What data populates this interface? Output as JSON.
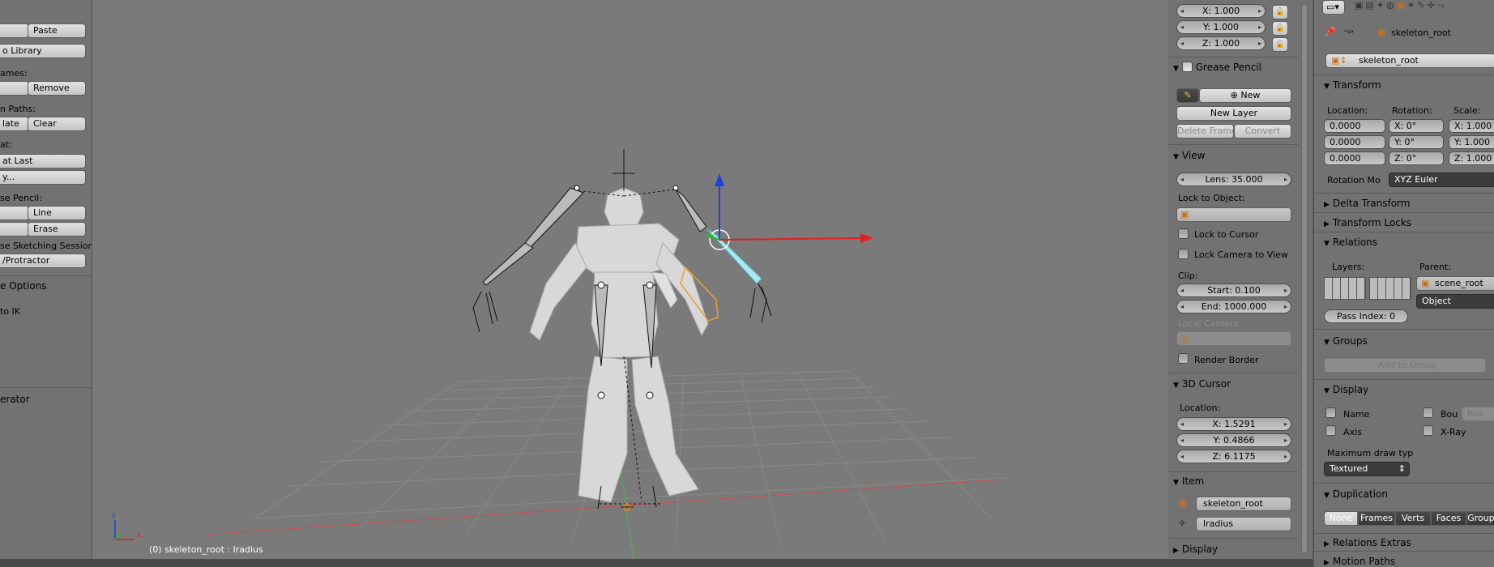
{
  "toolshelf": {
    "paste_label": "Paste",
    "copy_library_label": "o Library",
    "frames_label": "ames:",
    "remove_label": "Remove",
    "motion_paths_label": "n Paths:",
    "calculate_label": "late",
    "clear_label": "Clear",
    "repeat_label": "at:",
    "repeat_last_label": "at Last",
    "history_label": "y...",
    "grease_pencil_label": "se Pencil:",
    "line_label": "Line",
    "erase_label": "Erase",
    "sketching_sessions_label": "se Sketching Sessions",
    "protractor_label": "/Protractor",
    "options_label": "e Options",
    "auto_ik_label": "to IK",
    "operator_label": "erator"
  },
  "viewport": {
    "info_text": "(0) skeleton_root : lradius",
    "axis_x_label": "x",
    "axis_z_label": "z"
  },
  "npanel": {
    "scale_x": "X: 1.000",
    "scale_y": "Y: 1.000",
    "scale_z": "Z: 1.000",
    "grease_pencil_header": "Grease Pencil",
    "new_label": "New",
    "new_layer_label": "New Layer",
    "delete_frame_label": "Delete Frame",
    "convert_label": "Convert",
    "view_header": "View",
    "lens": "Lens: 35.000",
    "lock_to_object_label": "Lock to Object:",
    "lock_to_cursor_label": "Lock to Cursor",
    "lock_camera_label": "Lock Camera to View",
    "clip_label": "Clip:",
    "clip_start": "Start: 0.100",
    "clip_end": "End: 1000.000",
    "local_camera_label": "Local Camera:",
    "render_border_label": "Render Border",
    "cursor_header": "3D Cursor",
    "cursor_location_label": "Location:",
    "cursor_x": "X: 1.5291",
    "cursor_y": "Y: 0.4866",
    "cursor_z": "Z: 6.1175",
    "item_header": "Item",
    "item_object": "skeleton_root",
    "item_bone": "lradius",
    "display_header": "Display"
  },
  "props": {
    "breadcrumb_object": "skeleton_root",
    "object_name": "skeleton_root",
    "transform_header": "Transform",
    "location_label": "Location:",
    "rotation_label": "Rotation:",
    "scale_label": "Scale:",
    "loc_x": "0.0000",
    "loc_y": "0.0000",
    "loc_z": "0.0000",
    "rot_x": "X: 0°",
    "rot_y": "Y: 0°",
    "rot_z": "Z: 0°",
    "scale_x": "X: 1.000",
    "scale_y": "Y: 1.000",
    "scale_z": "Z: 1.000",
    "rotation_mode_label": "Rotation Mo",
    "rotation_mode_value": "XYZ Euler",
    "delta_transform_header": "Delta Transform",
    "transform_locks_header": "Transform Locks",
    "relations_header": "Relations",
    "layers_label": "Layers:",
    "parent_label": "Parent:",
    "parent_value": "scene_root",
    "parent_type": "Object",
    "pass_index": "Pass Index: 0",
    "groups_header": "Groups",
    "add_to_group_label": "Add to Group",
    "display_header": "Display",
    "name_label": "Name",
    "bounds_label": "Bou",
    "bounds_type": "Box",
    "axis_label": "Axis",
    "xray_label": "X-Ray",
    "max_draw_type_label": "Maximum draw typ",
    "draw_type_value": "Textured",
    "duplication_header": "Duplication",
    "dup_none": "None",
    "dup_frames": "Frames",
    "dup_verts": "Verts",
    "dup_faces": "Faces",
    "dup_group": "Group",
    "relations_extras_header": "Relations Extras",
    "motion_paths_header": "Motion Paths"
  },
  "colors": {
    "viewport_bg": "#7a7a7a",
    "panel_bg": "#727272",
    "x_axis": "#e02020",
    "y_axis": "#20c020",
    "z_axis": "#2040e0",
    "selected_bone": "#a8e8f0"
  }
}
